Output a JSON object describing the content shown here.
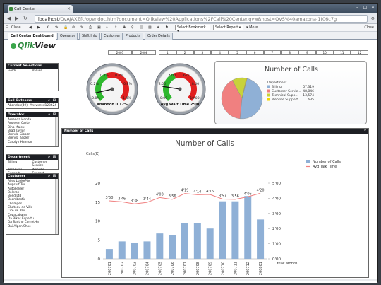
{
  "browser": {
    "tab_title": "Call Center",
    "url_host": "localhost",
    "url_path": "/QvAJAXZfc/opendoc.htm?document=Qlikview%20Applications%2FCall%20Center.qvw&host=QVS%40amazona-1t06c7g",
    "controls": {
      "minimize": "–",
      "maximize": "□",
      "close": "✕"
    }
  },
  "qv_toolbar": {
    "close_label": "Close",
    "bookmark_label": "Select Bookmark",
    "report_label": "Select Report",
    "more_label": "More",
    "right_close": "Close"
  },
  "tabs": [
    "Call Center Dashboard",
    "Operator",
    "Shift Info",
    "Customer",
    "Products",
    "Order Details"
  ],
  "logo": {
    "prefix": "Qlik",
    "suffix": "View"
  },
  "years": [
    "2007",
    "2008"
  ],
  "months": [
    "1",
    "2",
    "3",
    "4",
    "5",
    "6",
    "7",
    "8",
    "9",
    "10",
    "11",
    "12"
  ],
  "current_selections": {
    "title": "Current Selections",
    "col1": "Fields",
    "col2": "Values"
  },
  "call_outcome": {
    "title": "Call Outcome",
    "a_label": "Abandon",
    "a_val": "(49)",
    "b_label": "Answered",
    "b_val": "128624"
  },
  "operator": {
    "title": "Operator",
    "items": [
      "Amanda Honda",
      "Angelen Carter",
      "Bina Malek",
      "Brad Taylor",
      "Brenda Gibson",
      "Brenda Kegler",
      "Carolyn Halmon"
    ]
  },
  "department": {
    "title": "Department",
    "items": [
      [
        "Billing",
        "Customer Service"
      ],
      [
        "Technical Support",
        "Website Support"
      ]
    ]
  },
  "customer": {
    "title": "Customer",
    "items": [
      "Alles LuekePter",
      "Aupsurf Tuc",
      "AutoFelder",
      "Boleros",
      "Bond Ltd",
      "Boombastic",
      "Champes",
      "Chateau de Ville",
      "Cite de Pau",
      "Copacabana",
      "Da Bikes Expertu",
      "Da Santho CometHa",
      "Dai Alpen Shoe"
    ]
  },
  "gauges": [
    {
      "caption": "Abandon 0.12%",
      "ticks": [
        "0.4%",
        "0.6%",
        "0.2%",
        "0.8%",
        "0.0%",
        "1.0%"
      ],
      "value": 0.12,
      "max": 1.0
    },
    {
      "caption": "Avg Wait Time 2:00",
      "ticks": [
        "4:00",
        "6:00",
        "2:00",
        "8:00",
        "0:00",
        "10:00"
      ],
      "value": 2.0,
      "max": 10.0
    }
  ],
  "pie": {
    "title": "Number of Calls",
    "legend_title": "Department",
    "colors": [
      "#8fb0d6",
      "#f08080",
      "#c8d23a",
      "#f5d800"
    ],
    "labels": [
      "Billing",
      "Customer Servic...",
      "Technical Supp...",
      "Website Support"
    ],
    "display_values": [
      "57,319",
      "48,846",
      "13,574",
      "635"
    ]
  },
  "bar_panel": {
    "header": "Number of Calls",
    "menu_icon": "»"
  },
  "chart_data": {
    "type": "bar",
    "title": "Number of Calls",
    "ylabel": "Calls(K)",
    "xlabel": "Year Month",
    "categories": [
      "200701",
      "200702",
      "200703",
      "200704",
      "200705",
      "200706",
      "200707",
      "200708",
      "200709",
      "200710",
      "200711",
      "200712",
      "200801"
    ],
    "ylim": [
      0,
      20
    ],
    "y_ticks": [
      "20",
      "15",
      "10",
      "5",
      "0"
    ],
    "y2_ticks": [
      "5'00",
      "4'00",
      "3'00",
      "2'00",
      "1'00",
      "0'00"
    ],
    "y2lim": [
      0,
      5
    ],
    "legend": [
      {
        "label": "Number of Calls",
        "color": "#8fb0d6"
      },
      {
        "label": "Avg Talk Time",
        "color": "#f08080"
      }
    ],
    "series": [
      {
        "name": "Number of Calls",
        "values": [
          2.6,
          4.6,
          4.3,
          4.6,
          6.7,
          6.3,
          9.4,
          9.4,
          8.0,
          15.2,
          15.2,
          16.6,
          10.4
        ]
      },
      {
        "name": "Avg Talk Time",
        "values": [
          3.833,
          3.767,
          3.633,
          3.733,
          4.05,
          3.933,
          4.317,
          4.233,
          4.25,
          3.95,
          3.933,
          4.1,
          4.333
        ],
        "labels": [
          "3'50",
          "3'46",
          "3'38",
          "3'44",
          "4'03",
          "3'56",
          "4'19",
          "4'14",
          "4'15",
          "3'57",
          "3'56",
          "4'06",
          "4'20"
        ]
      }
    ]
  }
}
